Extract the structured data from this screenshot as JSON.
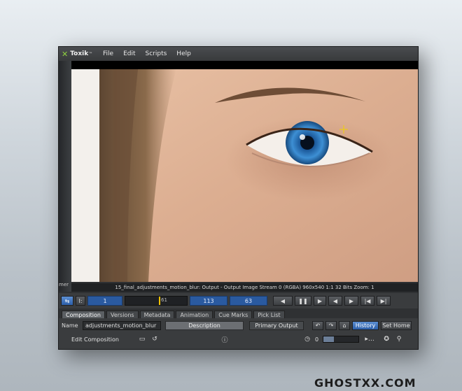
{
  "app": {
    "logo_text": "Toxik",
    "logo_superscript": "™",
    "menus": [
      "File",
      "Edit",
      "Scripts",
      "Help"
    ]
  },
  "left_strip_text": "mer",
  "viewer": {
    "status_text": "15_final_adjustments_motion_blur: Output - Output Image  Stream 0 (RGBA)  960x540  1:1  32 Bits  Zoom: 1"
  },
  "transport": {
    "start_frame": "1",
    "current_frame_marker": "61",
    "field_a": "113",
    "field_b": "63",
    "buttons": [
      "◀",
      "❚❚",
      "▶",
      "◀",
      "▶",
      "|◀",
      "▶|"
    ]
  },
  "tabs": [
    "Composition",
    "Versions",
    "Metadata",
    "Animation",
    "Cue Marks",
    "Pick List"
  ],
  "active_tab": "Composition",
  "panel": {
    "name_label": "Name",
    "name_value": "adjustments_motion_blur",
    "description_label": "Description",
    "primary_output_label": "Primary Output",
    "history_label": "History",
    "set_home_label": "Set Home",
    "edit_composition_label": "Edit Composition",
    "counter_value": "0",
    "slider_level": 0.3
  },
  "watermark": "GHOSTXX.COM",
  "colors": {
    "accent_blue": "#2c5ea8",
    "logo_green": "#8fd13f",
    "playhead": "#f2c200"
  }
}
